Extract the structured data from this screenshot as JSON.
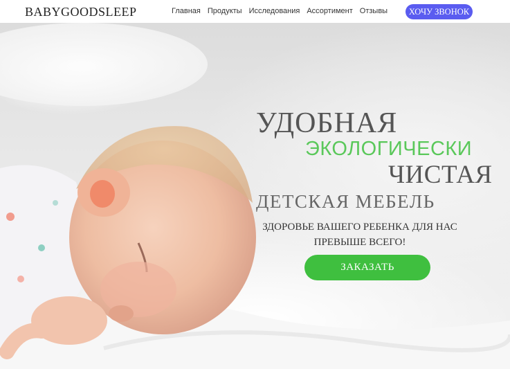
{
  "header": {
    "logo": "BABYGOODSLEEP",
    "nav": [
      "Главная",
      "Продукты",
      "Исследования",
      "Ассортимент",
      "Отзывы"
    ],
    "call_button": "ХОЧУ ЗВОНОК"
  },
  "hero": {
    "line1": "УДОБНАЯ",
    "line2": "ЭКОЛОГИЧЕСКИ",
    "line3": "ЧИСТАЯ",
    "line4": "ДЕТСКАЯ МЕБЕЛЬ",
    "subtitle_line1": "ЗДОРОВЬЕ ВАШЕГО РЕБЕНКА ДЛЯ НАС",
    "subtitle_line2": "ПРЕВЫШЕ ВСЕГО!",
    "order_button": "ЗАКАЗАТЬ"
  },
  "colors": {
    "accent_green": "#5ac85a",
    "button_green": "#3fbf3f",
    "call_button": "#5a5cf0"
  }
}
